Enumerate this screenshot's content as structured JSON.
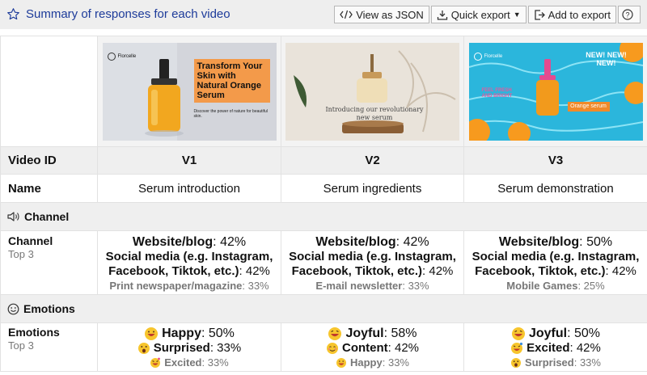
{
  "header": {
    "title": "Summary of responses for each video",
    "buttons": {
      "json": "View as JSON",
      "export": "Quick export",
      "add": "Add to export",
      "help": "?"
    }
  },
  "rows": {
    "video_id": "Video ID",
    "name": "Name"
  },
  "sections": {
    "channel": "Channel",
    "emotions": "Emotions"
  },
  "row_labels": {
    "channel": "Channel",
    "channel_sub": "Top 3",
    "emotions": "Emotions",
    "emotions_sub": "Top 3"
  },
  "videos": [
    {
      "id": "V1",
      "name": "Serum introduction",
      "thumb": {
        "brand": "Florcelle",
        "headline": "Transform Your Skin with Natural Orange Serum",
        "subline": "Discover the power of nature for beautiful skin."
      },
      "channel": [
        {
          "label": "Website/blog",
          "pct": ": 42%"
        },
        {
          "label": "Social media (e.g. Instagram, Facebook, Tiktok, etc.)",
          "pct": ": 42%"
        },
        {
          "label": "Print newspaper/magazine",
          "pct": ": 33%"
        }
      ],
      "emotions": [
        {
          "icon": "happy-face-icon",
          "label": "Happy",
          "pct": ": 50%"
        },
        {
          "icon": "surprised-face-icon",
          "label": "Surprised",
          "pct": ": 33%"
        },
        {
          "icon": "excited-face-icon",
          "label": "Excited",
          "pct": ": 33%"
        }
      ]
    },
    {
      "id": "V2",
      "name": "Serum ingredients",
      "thumb": {
        "brand": "",
        "intro": "Introducing our revolutionary new serum"
      },
      "channel": [
        {
          "label": "Website/blog",
          "pct": ": 42%"
        },
        {
          "label": "Social media (e.g. Instagram, Facebook, Tiktok, etc.)",
          "pct": ": 42%"
        },
        {
          "label": "E-mail newsletter",
          "pct": ": 33%"
        }
      ],
      "emotions": [
        {
          "icon": "joyful-face-icon",
          "label": "Joyful",
          "pct": ": 58%"
        },
        {
          "icon": "content-face-icon",
          "label": "Content",
          "pct": ": 42%"
        },
        {
          "icon": "happy-face-icon",
          "label": "Happy",
          "pct": ": 33%"
        }
      ]
    },
    {
      "id": "V3",
      "name": "Serum demonstration",
      "thumb": {
        "brand": "Florcelle",
        "new": "NEW! NEW! NEW!",
        "fresh": "FEEL FRESH AND BRIGHT",
        "tag": "Orange serum"
      },
      "channel": [
        {
          "label": "Website/blog",
          "pct": ": 50%"
        },
        {
          "label": "Social media (e.g. Instagram, Facebook, Tiktok, etc.)",
          "pct": ": 42%"
        },
        {
          "label": "Mobile Games",
          "pct": ": 25%"
        }
      ],
      "emotions": [
        {
          "icon": "joyful-face-icon",
          "label": "Joyful",
          "pct": ": 50%"
        },
        {
          "icon": "excited-face-icon",
          "label": "Excited",
          "pct": ": 42%"
        },
        {
          "icon": "surprised-face-icon",
          "label": "Surprised",
          "pct": ": 33%"
        }
      ]
    }
  ],
  "colors": {
    "title": "#1d3b9a",
    "header_bg": "#eeeeee",
    "muted": "#777777",
    "serum_orange": "#f39a4a",
    "pool_blue": "#2bb8dd"
  }
}
